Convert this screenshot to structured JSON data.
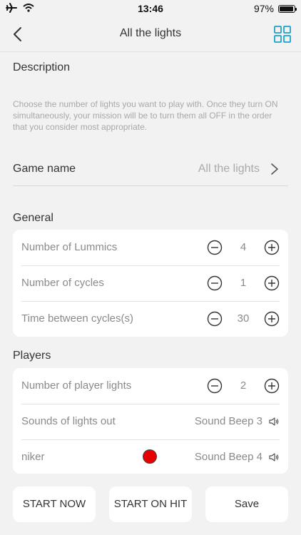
{
  "status": {
    "time": "13:46",
    "battery": "97%",
    "battery_level": 0.97
  },
  "nav": {
    "title": "All the lights"
  },
  "description": {
    "title": "Description",
    "text": "Choose the number of lights you want to play with. Once they turn ON simultaneously, your mission will be to turn them all OFF in the order that you consider most appropriate."
  },
  "game": {
    "label": "Game name",
    "value": "All the lights"
  },
  "general": {
    "title": "General",
    "rows": [
      {
        "label": "Number of Lummics",
        "value": "4"
      },
      {
        "label": "Number of cycles",
        "value": "1"
      },
      {
        "label": "Time between cycles(s)",
        "value": "30"
      }
    ]
  },
  "players": {
    "title": "Players",
    "player_lights": {
      "label": "Number of player lights",
      "value": "2"
    },
    "sounds_out": {
      "label": "Sounds of lights out",
      "sound": "Sound Beep 3"
    },
    "player": {
      "name": "niker",
      "sound": "Sound Beep 4",
      "color": "#e60000"
    }
  },
  "buttons": {
    "start_now": "START NOW",
    "start_on_hit": "START ON HIT",
    "save": "Save"
  }
}
